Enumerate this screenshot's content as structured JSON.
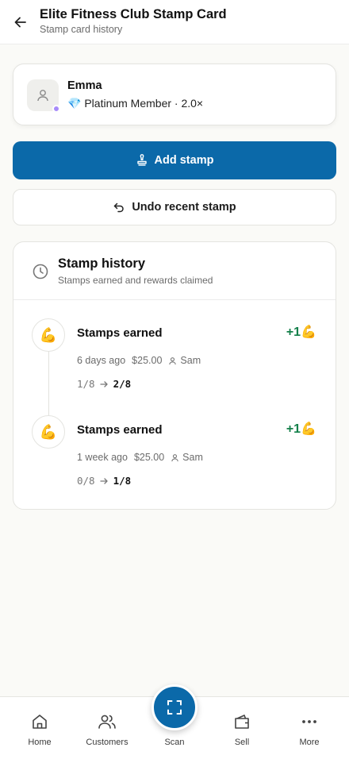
{
  "header": {
    "title": "Elite Fitness Club Stamp Card",
    "subtitle": "Stamp card history",
    "back_icon": "arrow-left-icon"
  },
  "member": {
    "name": "Emma",
    "tier_emoji": "💎",
    "tier_text": "Platinum Member · 2.0×",
    "status_dot_color": "#a78bfa"
  },
  "actions": {
    "add_stamp_label": "Add stamp",
    "undo_label": "Undo recent stamp"
  },
  "history": {
    "title": "Stamp history",
    "subtitle": "Stamps earned and rewards claimed",
    "entries": [
      {
        "emoji": "💪",
        "title": "Stamps earned",
        "delta": "+1💪",
        "time": "6 days ago",
        "amount": "$25.00",
        "staff": "Sam",
        "from": "1/8",
        "to": "2/8"
      },
      {
        "emoji": "💪",
        "title": "Stamps earned",
        "delta": "+1💪",
        "time": "1 week ago",
        "amount": "$25.00",
        "staff": "Sam",
        "from": "0/8",
        "to": "1/8"
      }
    ]
  },
  "nav": {
    "home": "Home",
    "customers": "Customers",
    "scan": "Scan",
    "sell": "Sell",
    "more": "More"
  },
  "colors": {
    "primary": "#0b69a9",
    "positive": "#14804a"
  }
}
